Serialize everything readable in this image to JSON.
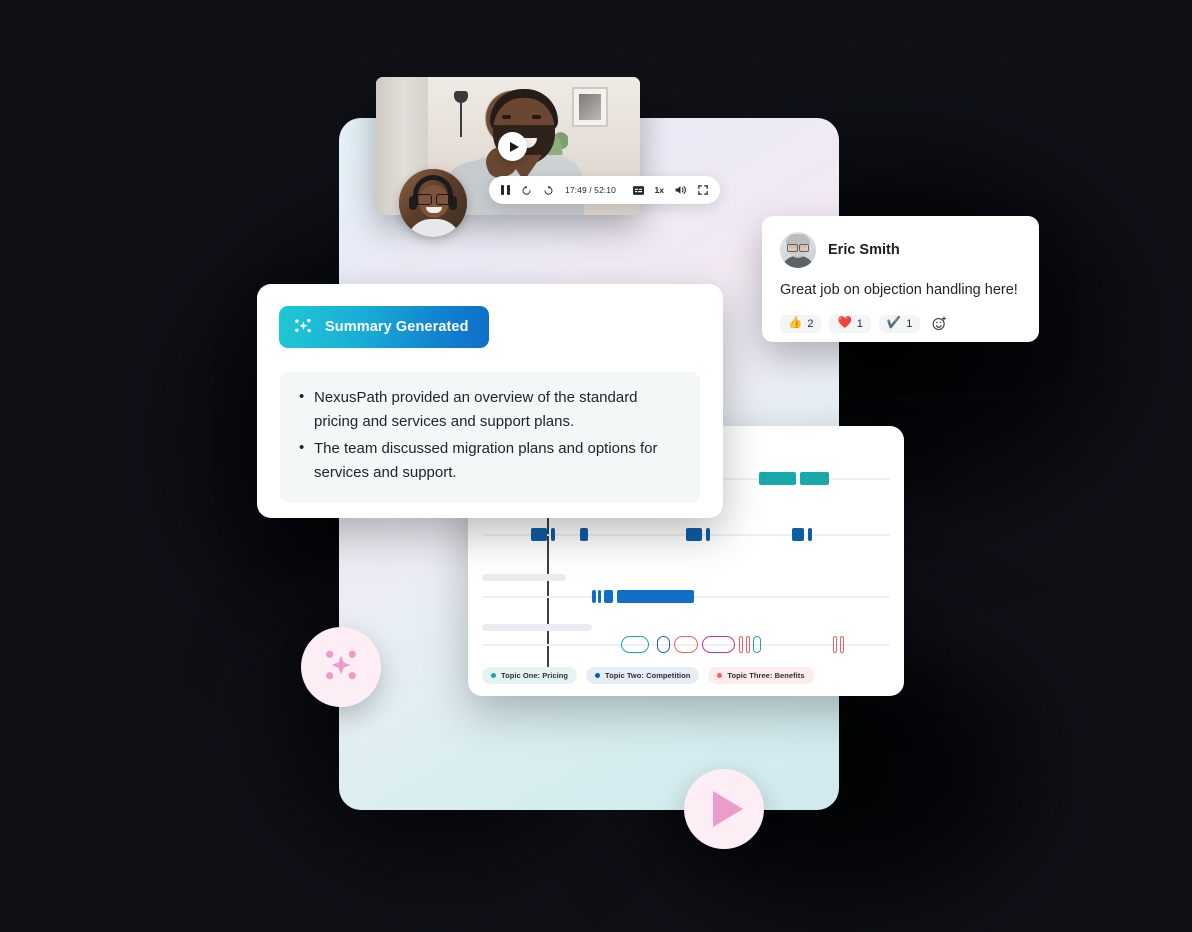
{
  "video": {
    "overlay_play_icon": "play-icon",
    "controls": {
      "pause_icon": "pause-icon",
      "rewind_icon": "rewind-15-icon",
      "forward_icon": "forward-15-icon",
      "time_display": "17:49 / 52:10",
      "current_time": "17:49",
      "duration": "52:10",
      "captions_icon": "captions-icon",
      "speed_label": "1x",
      "volume_icon": "volume-icon",
      "fullscreen_icon": "fullscreen-icon"
    },
    "participant_avatar_icon": "participant-avatar"
  },
  "summary": {
    "badge_label": "Summary Generated",
    "badge_icon": "sparkle-icon",
    "badge_gradient_from": "#1ec8d4",
    "badge_gradient_to": "#0f6fc8",
    "bullets": [
      "NexusPath provided an overview of the standard pricing and services and support plans.",
      "The team discussed migration plans and options for services and support."
    ]
  },
  "comment": {
    "author": "Eric Smith",
    "avatar_icon": "commenter-avatar",
    "text": "Great job on objection handling here!",
    "reactions": [
      {
        "name": "thumbs-up",
        "emoji": "👍",
        "count": "2"
      },
      {
        "name": "heart",
        "emoji": "❤️",
        "count": "1"
      },
      {
        "name": "check",
        "emoji": "✔️",
        "count": "1"
      }
    ],
    "add_reaction_icon": "add-reaction-icon"
  },
  "chart_data": {
    "type": "timeline",
    "title": "",
    "xlabel": "",
    "ylabel": "",
    "xlim": [
      0,
      100
    ],
    "grid": false,
    "legend_position": "bottom-left",
    "playhead_position_pct": 16,
    "legend": [
      {
        "label": "Topic One: Pricing",
        "color": "#1aa9ab",
        "chip_bg": "#e4f4f3"
      },
      {
        "label": "Topic Two: Competition",
        "color": "#0d5fa5",
        "chip_bg": "#e6edf5"
      },
      {
        "label": "Topic Three: Benefits",
        "color": "#f4615c",
        "chip_bg": "#fdeceb"
      }
    ],
    "series": [
      {
        "name": "Topic One: Pricing",
        "color": "#1aa9ab",
        "style": "filled",
        "row": 0,
        "segments": [
          {
            "start": 68,
            "end": 77
          },
          {
            "start": 78,
            "end": 85
          }
        ]
      },
      {
        "name": "Topic Two: Competition",
        "color": "#0d5fa5",
        "style": "filled",
        "row": 1,
        "segments": [
          {
            "start": 12,
            "end": 16
          },
          {
            "start": 17,
            "end": 18
          },
          {
            "start": 24,
            "end": 26
          },
          {
            "start": 50,
            "end": 54
          },
          {
            "start": 55,
            "end": 56
          },
          {
            "start": 76,
            "end": 79
          },
          {
            "start": 80,
            "end": 81
          }
        ]
      },
      {
        "name": "Topic Two: Competition",
        "color": "#0f6fc8",
        "style": "filled",
        "row": 2,
        "segments": [
          {
            "start": 27,
            "end": 28
          },
          {
            "start": 28.5,
            "end": 29.2
          },
          {
            "start": 30,
            "end": 32
          },
          {
            "start": 33,
            "end": 52
          }
        ]
      },
      {
        "name": "Topic Three: Benefits",
        "color": "#f4615c",
        "style": "outlined",
        "row": 3,
        "segments": [
          {
            "start": 34,
            "end": 41,
            "color": "#1aa9ab"
          },
          {
            "start": 43,
            "end": 46,
            "color": "#2c5fa8"
          },
          {
            "start": 47,
            "end": 53,
            "color": "#f4615c"
          },
          {
            "start": 54,
            "end": 62,
            "color": "#c2348f"
          },
          {
            "start": 63,
            "end": 64,
            "color": "#f4615c"
          },
          {
            "start": 64.8,
            "end": 65.6,
            "color": "#f4615c"
          },
          {
            "start": 66.4,
            "end": 68.5,
            "color": "#1aa9ab"
          },
          {
            "start": 86,
            "end": 87,
            "color": "#f4615c"
          },
          {
            "start": 87.8,
            "end": 88.8,
            "color": "#f4615c"
          }
        ]
      }
    ]
  },
  "decorations": {
    "sparkle_bubble_icon": "sparkle-icon",
    "play_bubble_icon": "play-icon",
    "accent_pink": "#eb9ccb",
    "bubble_bg": "#fdeef5"
  }
}
